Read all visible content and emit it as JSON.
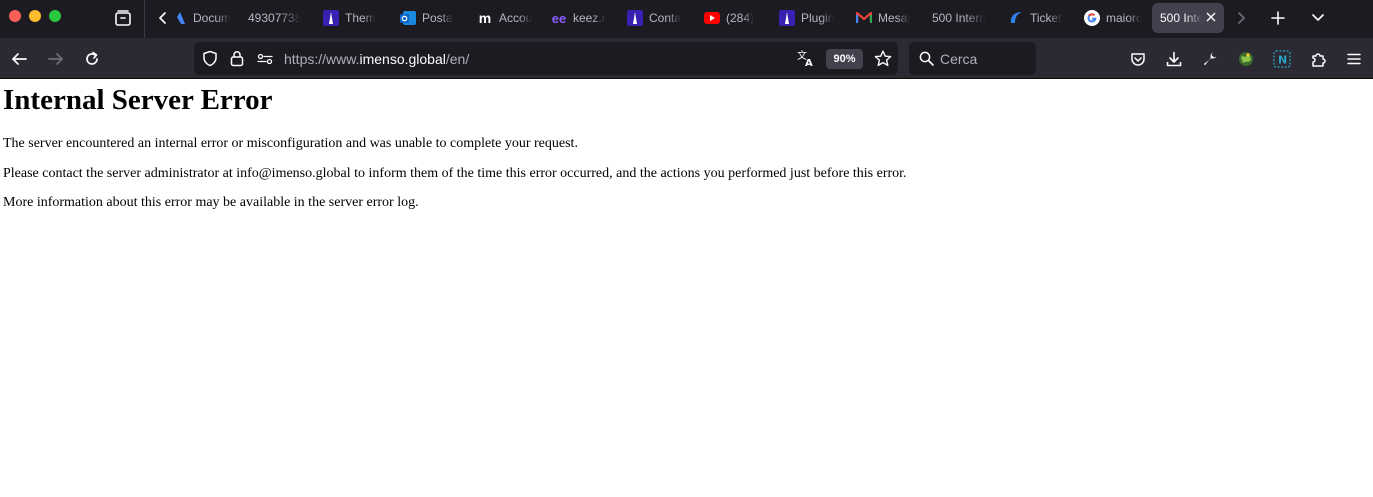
{
  "tabs": [
    {
      "label": "Docum",
      "favicon": "google-docs-icon",
      "color": "#4285f4"
    },
    {
      "label": "49307738",
      "favicon": "none",
      "color": ""
    },
    {
      "label": "Them",
      "favicon": "theme-icon",
      "color": "#5b3fd9"
    },
    {
      "label": "Posta",
      "favicon": "outlook-icon",
      "color": "#0a64c8"
    },
    {
      "label": "Accou",
      "favicon": "m-logo-icon",
      "color": "#ffffff"
    },
    {
      "label": "keez.r",
      "favicon": "keez-icon",
      "color": "#8a5cff"
    },
    {
      "label": "Conta",
      "favicon": "theme-icon",
      "color": "#5b3fd9"
    },
    {
      "label": "(284)",
      "favicon": "youtube-icon",
      "color": "#ff0000"
    },
    {
      "label": "Plugin",
      "favicon": "theme-icon",
      "color": "#5b3fd9"
    },
    {
      "label": "Mesaj",
      "favicon": "gmail-icon",
      "color": "#ea4335"
    },
    {
      "label": "500 Intern",
      "favicon": "none",
      "color": ""
    },
    {
      "label": "Ticket",
      "favicon": "bird-icon",
      "color": "#2f80ed"
    },
    {
      "label": "maiorc",
      "favicon": "google-icon",
      "color": "#4285f4"
    },
    {
      "label": "500 Inte",
      "favicon": "none",
      "color": "",
      "active": true
    }
  ],
  "urlbar": {
    "url_prefix": "https://www.",
    "url_domain": "imenso.global",
    "url_path": "/en/",
    "zoom": "90%"
  },
  "search": {
    "placeholder": "Cerca"
  },
  "page": {
    "title": "Internal Server Error",
    "p1": "The server encountered an internal error or misconfiguration and was unable to complete your request.",
    "p2": "Please contact the server administrator at info@imenso.global to inform them of the time this error occurred, and the actions you performed just before this error.",
    "p3": "More information about this error may be available in the server error log."
  }
}
